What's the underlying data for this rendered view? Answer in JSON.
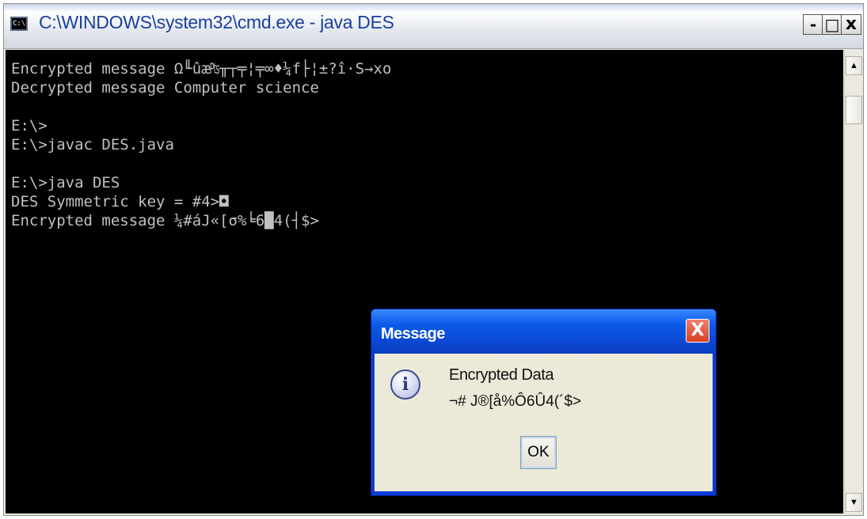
{
  "window": {
    "title": "C:\\WINDOWS\\system32\\cmd.exe - java DES",
    "icon_label": "C:\\",
    "minimize_label": "-",
    "maximize_label": "□",
    "close_label": "x"
  },
  "console": {
    "lines": [
      "Encrypted message Ω╙ûæ₧╥┬╤¦╤∞♦¼f├¦±?î·S→xo",
      "Decrypted message Computer science",
      "",
      "E:\\>",
      "E:\\>javac DES.java",
      "",
      "E:\\>java DES",
      "DES Symmetric key = #4>◘",
      "Encrypted message ¼#áJ«[σ%╘6█4(┤$>"
    ]
  },
  "scrollbar": {
    "up_label": "▲",
    "down_label": "▼"
  },
  "dialog": {
    "title": "Message",
    "close_label": "X",
    "icon_label": "i",
    "heading": "Encrypted Data",
    "value": "¬# J®[å%Ô6Û4(´$>",
    "ok_label": "OK"
  }
}
